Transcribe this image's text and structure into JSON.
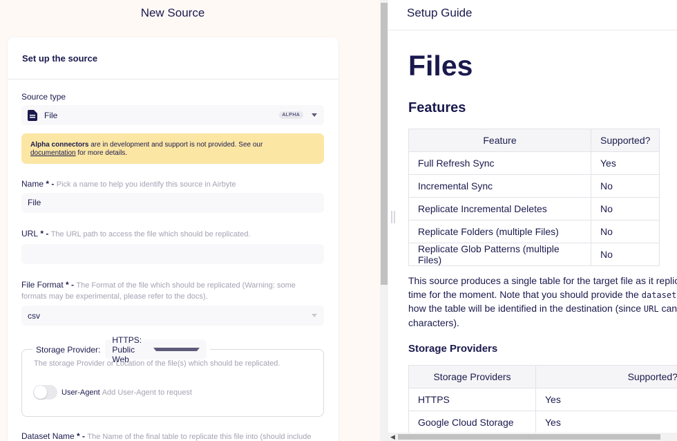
{
  "left": {
    "header_title": "New Source",
    "card_title": "Set up the source",
    "source_type": {
      "label": "Source type",
      "value": "File",
      "badge": "ALPHA"
    },
    "warning": {
      "bold": "Alpha connectors",
      "text": " are in development and support is not provided. See our",
      "link": "documentation",
      "tail": " for more details."
    },
    "name": {
      "label": "Name",
      "required": " * - ",
      "hint": "Pick a name to help you identify this source in Airbyte",
      "value": "File"
    },
    "url": {
      "label": "URL",
      "required": " * - ",
      "hint": "The URL path to access the file which should be replicated.",
      "value": ""
    },
    "file_format": {
      "label": "File Format",
      "required": " * - ",
      "hint": "The Format of the file which should be replicated (Warning: some formats may be experimental, please refer to the docs).",
      "value": "csv"
    },
    "storage": {
      "label": "Storage Provider:",
      "value": "HTTPS: Public Web",
      "description": "The storage Provider or Location of the file(s) which should be replicated.",
      "toggle_label": "User-Agent",
      "toggle_hint": "Add User-Agent to request"
    },
    "dataset_name": {
      "label": "Dataset Name",
      "required": " * - ",
      "hint": "The Name of the final table to replicate this file into (should include letters, numbers dash and underscores only)."
    }
  },
  "right": {
    "header_title": "Setup Guide",
    "h1": "Files",
    "features_title": "Features",
    "features_table": {
      "headers": [
        "Feature",
        "Supported?"
      ],
      "rows": [
        [
          "Full Refresh Sync",
          "Yes"
        ],
        [
          "Incremental Sync",
          "No"
        ],
        [
          "Replicate Incremental Deletes",
          "No"
        ],
        [
          "Replicate Folders (multiple Files)",
          "No"
        ],
        [
          "Replicate Glob Patterns (multiple Files)",
          "No"
        ]
      ]
    },
    "paragraph": {
      "line1": "This source produces a single table for the target file as it replic",
      "line2a": "time for the moment. Note that you should provide the ",
      "line2code": "dataset",
      "line3a": "how the table will be identified in the destination (since ",
      "line3code": "URL",
      "line3b": " can",
      "line4": "characters)."
    },
    "providers_title": "Storage Providers",
    "providers_table": {
      "headers": [
        "Storage Providers",
        "Supported?"
      ],
      "rows": [
        [
          "HTTPS",
          "Yes"
        ],
        [
          "Google Cloud Storage",
          "Yes"
        ]
      ]
    }
  }
}
